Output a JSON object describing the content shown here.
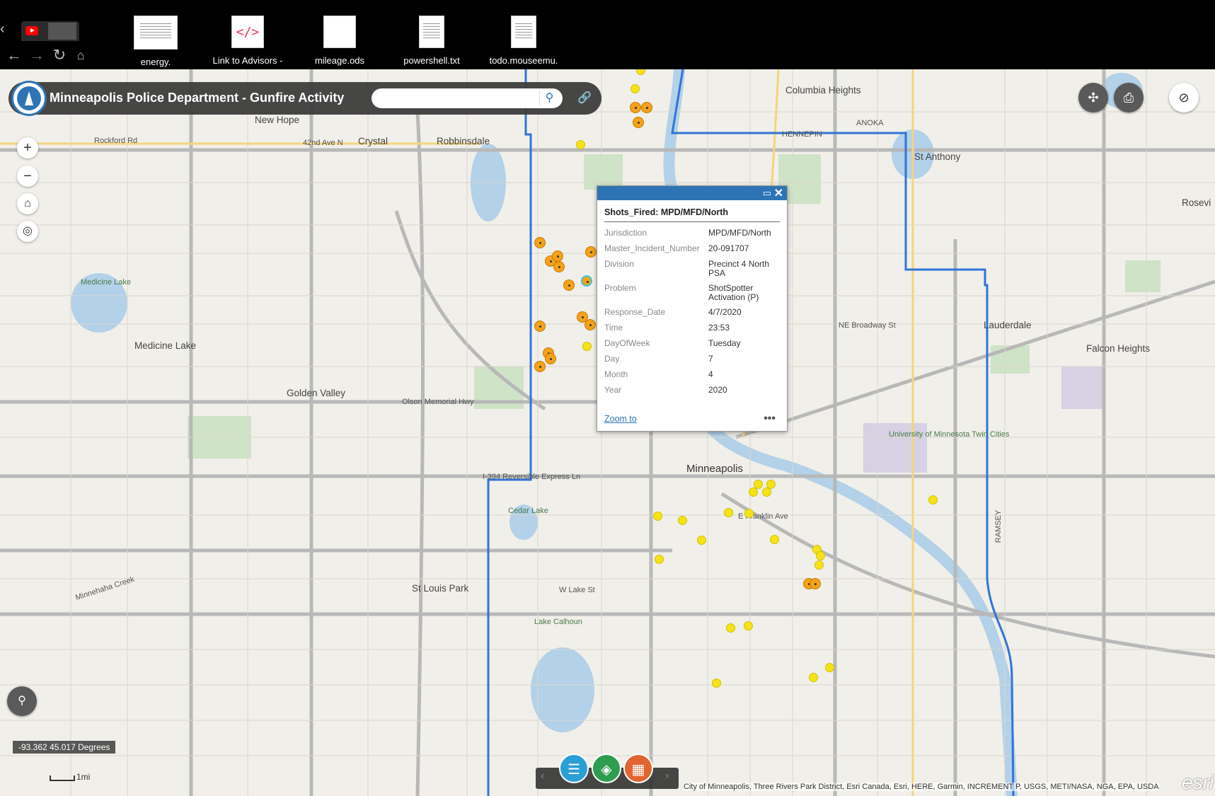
{
  "desktop": {
    "icons": [
      {
        "label": "energy."
      },
      {
        "label": "Link to Advisors -"
      },
      {
        "label": "mileage.ods"
      },
      {
        "label": "powershell.txt"
      },
      {
        "label": "todo.mouseemu."
      }
    ]
  },
  "app": {
    "title": "Minneapolis Police Department - Gunfire Activity",
    "search_placeholder": ""
  },
  "popup": {
    "heading": "Shots_Fired: MPD/MFD/North",
    "fields": [
      {
        "key": "Jurisdiction",
        "value": "MPD/MFD/North"
      },
      {
        "key": "Master_Incident_Number",
        "value": "20-091707"
      },
      {
        "key": "Division",
        "value": "Precinct 4 North PSA"
      },
      {
        "key": "Problem",
        "value": "ShotSpotter Activation (P)"
      },
      {
        "key": "Response_Date",
        "value": "4/7/2020"
      },
      {
        "key": "Time",
        "value": "23:53"
      },
      {
        "key": "DayOfWeek",
        "value": "Tuesday"
      },
      {
        "key": "Day",
        "value": "7"
      },
      {
        "key": "Month",
        "value": "4"
      },
      {
        "key": "Year",
        "value": "2020"
      }
    ],
    "zoom_to": "Zoom to",
    "more": "•••"
  },
  "map": {
    "coords": "-93.362 45.017 Degrees",
    "scale": "1mi",
    "attribution": "City of Minneapolis, Three Rivers Park District, Esri Canada, Esri, HERE, Garmin, INCREMENT P, USGS, METI/NASA, NGA, EPA, USDA",
    "esri": "esri",
    "places": [
      {
        "name": "Minneapolis",
        "cls": "big"
      },
      {
        "name": "Columbia Heights",
        "cls": "mid"
      },
      {
        "name": "St Anthony",
        "cls": "mid"
      },
      {
        "name": "New Hope",
        "cls": "mid"
      },
      {
        "name": "Crystal",
        "cls": "mid"
      },
      {
        "name": "Robbinsdale",
        "cls": "mid"
      },
      {
        "name": "Medicine Lake",
        "cls": "mid"
      },
      {
        "name": "Golden Valley",
        "cls": "mid"
      },
      {
        "name": "St Louis Park",
        "cls": "mid"
      },
      {
        "name": "Lauderdale",
        "cls": "mid"
      },
      {
        "name": "Falcon Heights",
        "cls": "mid"
      },
      {
        "name": "Rosevi",
        "cls": "mid"
      },
      {
        "name": "Lake Calhoun",
        "cls": "green"
      },
      {
        "name": "Cedar Lake",
        "cls": "green"
      },
      {
        "name": "Medicine Lake",
        "cls": "green"
      },
      {
        "name": "Olson Memorial Hwy",
        "cls": "road"
      },
      {
        "name": "I-394 Reversible Express Ln",
        "cls": "road"
      },
      {
        "name": "NE Broadway St",
        "cls": "road"
      },
      {
        "name": "Rockford Rd",
        "cls": "road"
      },
      {
        "name": "42nd Ave N",
        "cls": "road"
      },
      {
        "name": "Minnehaha Creek",
        "cls": "road"
      },
      {
        "name": "W Lake St",
        "cls": "road"
      },
      {
        "name": "E Franklin Ave",
        "cls": "road"
      },
      {
        "name": "University of Minnesota Twin Cities",
        "cls": "green"
      },
      {
        "name": "HENNEPIN",
        "cls": "road"
      },
      {
        "name": "ANOKA",
        "cls": "road"
      },
      {
        "name": "RAMSEY",
        "cls": "road"
      }
    ]
  },
  "icons": {
    "home": "home-icon",
    "locate": "locate-icon",
    "search": "search-icon",
    "link": "link-icon",
    "print": "print-icon",
    "visibility": "eye-off-icon",
    "legend": "list-icon",
    "layers": "layers-icon",
    "basemap": "grid-icon"
  },
  "colors": {
    "accent": "#2e74b5",
    "boundary": "#2e74d9",
    "point_yellow": "#f5e31a",
    "point_orange": "#f3a21b",
    "header_bg": "#3c3c3c"
  }
}
